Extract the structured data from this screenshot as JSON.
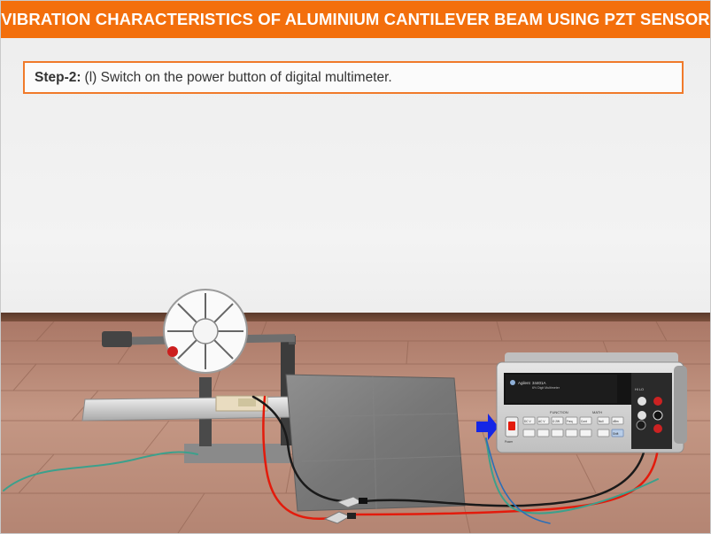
{
  "header": {
    "title": "VIBRATION CHARACTERISTICS OF ALUMINIUM CANTILEVER BEAM USING PZT SENSOR",
    "background": "#f36f0c"
  },
  "instruction": {
    "step_label": "Step-2:",
    "text": "(l) Switch on the power button of digital multimeter.",
    "border_color": "#f07a2a"
  },
  "multimeter": {
    "brand": "Agilent",
    "model": "34401A",
    "subtitle": "6½ Digit Multimeter",
    "function_label": "FUNCTION",
    "math_label": "MATH",
    "keys_top": [
      "DC V",
      "AC V",
      "Ω 2W",
      "Freq",
      "Cont",
      "Null",
      "dBm"
    ],
    "keys_bottom": [
      "",
      "",
      "",
      "",
      "",
      "",
      "",
      "Shift"
    ],
    "power_label": "Power",
    "terminal_label": "HI LO"
  },
  "colors": {
    "arrow": "#1426e6",
    "wire_red": "#e31b0c",
    "wire_black": "#1a1a1a",
    "wire_green": "#3ca08c",
    "floor": "#b88470"
  },
  "icons": {
    "pointer": "blue-arrow-icon",
    "clip": "alligator-clip-icon"
  }
}
